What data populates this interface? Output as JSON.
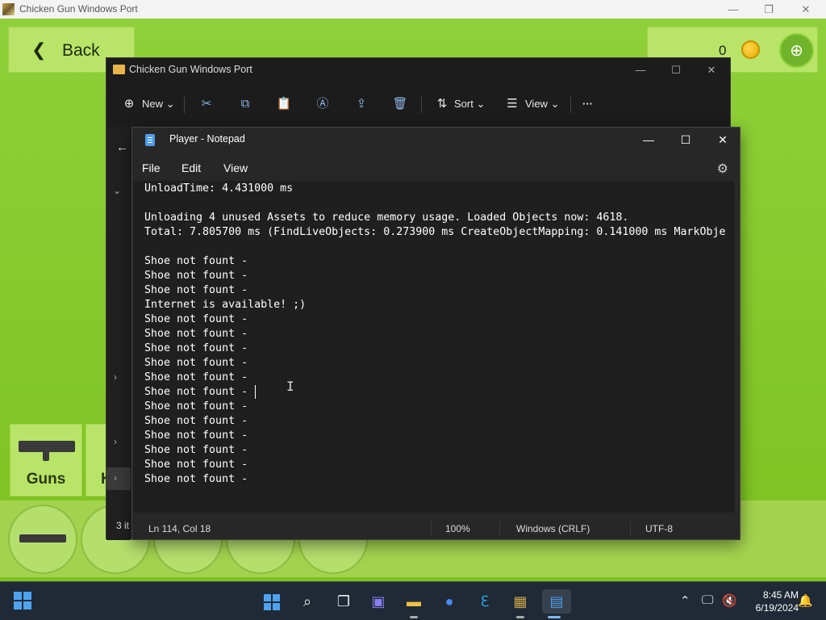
{
  "game": {
    "window_title": "Chicken Gun Windows Port",
    "back_label": "Back",
    "coins": "0",
    "cards": [
      {
        "label": "Guns"
      },
      {
        "label": "K"
      }
    ]
  },
  "explorer": {
    "title": "Chicken Gun Windows Port",
    "toolbar": {
      "new_label": "New",
      "sort_label": "Sort",
      "view_label": "View",
      "more_label": "···"
    },
    "status": "3 it"
  },
  "notepad": {
    "title": "Player - Notepad",
    "menu": [
      "File",
      "Edit",
      "View"
    ],
    "lines": [
      "UnloadTime: 4.431000 ms",
      "",
      "Unloading 4 unused Assets to reduce memory usage. Loaded Objects now: 4618.",
      "Total: 7.805700 ms (FindLiveObjects: 0.273900 ms CreateObjectMapping: 0.141000 ms MarkObje",
      "",
      "Shoe not fount -",
      "Shoe not fount -",
      "Shoe not fount -",
      "Internet is available! ;)",
      "Shoe not fount -",
      "Shoe not fount -",
      "Shoe not fount -",
      "Shoe not fount -",
      "Shoe not fount -",
      "Shoe not fount -",
      "Shoe not fount -",
      "Shoe not fount -",
      "Shoe not fount -",
      "Shoe not fount -",
      "Shoe not fount -",
      "Shoe not fount -"
    ],
    "status": {
      "position": "Ln 114, Col 18",
      "zoom": "100%",
      "line_ending": "Windows (CRLF)",
      "encoding": "UTF-8"
    }
  },
  "taskbar": {
    "time": "8:45 AM",
    "date": "6/19/2024"
  },
  "colors": {
    "game_green": "#86c82d",
    "notepad_bg": "#1f1f1f",
    "taskbar_bg": "#202a36",
    "accent_blue": "#4ea3f0"
  }
}
